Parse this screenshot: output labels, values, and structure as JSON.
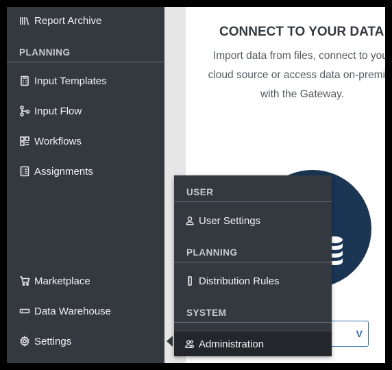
{
  "sidebar": {
    "top_items": [
      {
        "label": "Report Archive",
        "icon": "books-icon"
      }
    ],
    "planning_header": "PLANNING",
    "planning_items": [
      {
        "label": "Input Templates",
        "icon": "calculator-icon"
      },
      {
        "label": "Input Flow",
        "icon": "flow-icon"
      },
      {
        "label": "Workflows",
        "icon": "workflow-grid-icon"
      },
      {
        "label": "Assignments",
        "icon": "checklist-icon"
      }
    ],
    "bottom_items": [
      {
        "label": "Marketplace",
        "icon": "cart-icon"
      },
      {
        "label": "Data Warehouse",
        "icon": "server-icon"
      },
      {
        "label": "Settings",
        "icon": "gear-icon"
      }
    ]
  },
  "main": {
    "title": "CONNECT TO YOUR DATA",
    "description": "Import data from files, connect to your cloud source or access data on-premise with the Gateway.",
    "button_label": "V"
  },
  "settings_menu": {
    "sections": [
      {
        "header": "USER",
        "items": [
          {
            "label": "User Settings",
            "icon": "user-icon"
          }
        ]
      },
      {
        "header": "PLANNING",
        "items": [
          {
            "label": "Distribution Rules",
            "icon": "ruler-icon"
          }
        ]
      },
      {
        "header": "SYSTEM",
        "items": [
          {
            "label": "Administration",
            "icon": "admin-users-icon"
          }
        ]
      }
    ]
  },
  "colors": {
    "sidebar_bg": "#343940",
    "accent_blue": "#2f6dab",
    "circle_navy": "#1b3554"
  }
}
